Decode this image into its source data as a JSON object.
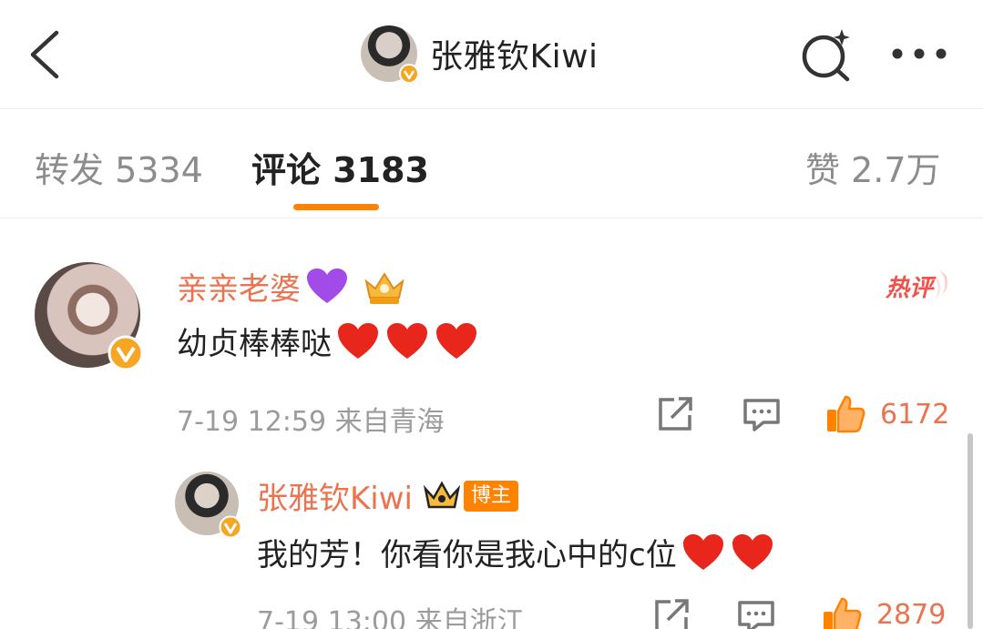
{
  "header": {
    "title": "张雅钦Kiwi",
    "icons": {
      "back": "chevron-left-icon",
      "search": "search-sparkle-icon",
      "more": "more-dots-icon"
    }
  },
  "tabs": {
    "repost": "转发 5334",
    "comments": "评论 3183",
    "likes": "赞 2.7万",
    "active": "comments",
    "accent_color": "#ff8200"
  },
  "comment": {
    "username": "亲亲老婆",
    "content": "幼贞棒棒哒",
    "hot_label": "热评",
    "timestamp": "7-19 12:59",
    "location": "来自青海",
    "like_count": "6172",
    "name_color": "#eb7350"
  },
  "reply": {
    "username": "张雅钦Kiwi",
    "owner_tag": "博主",
    "content": "我的芳！你看你是我心中的c位",
    "timestamp": "7-19 13:00",
    "location": "来自浙江",
    "like_count": "2879"
  }
}
